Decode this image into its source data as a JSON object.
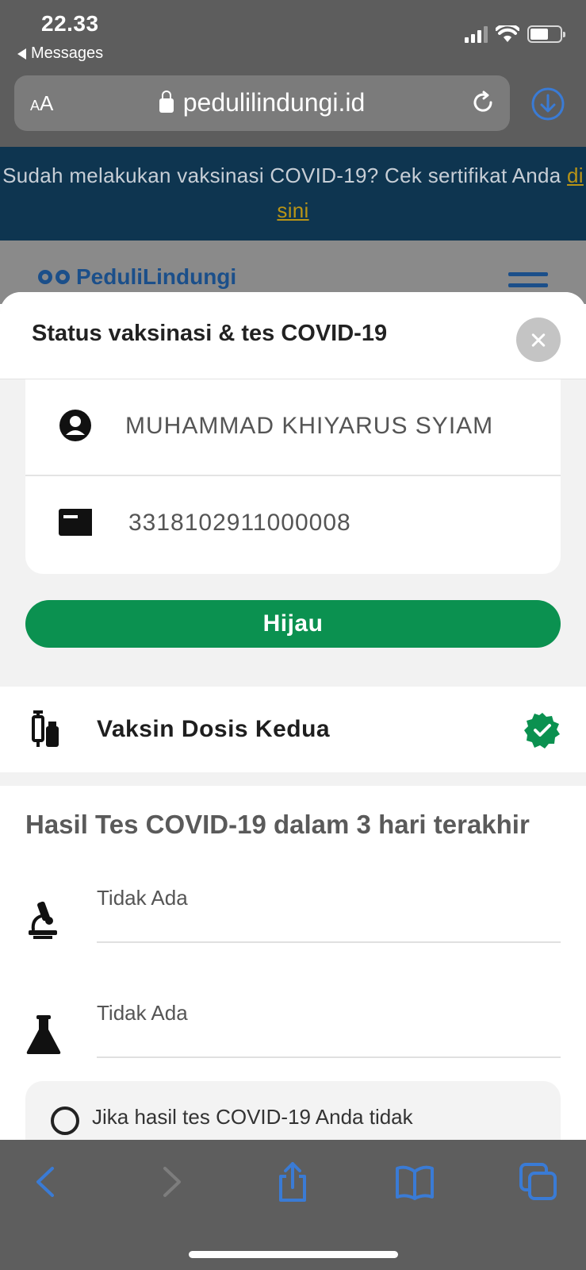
{
  "status_bar": {
    "time": "22.33",
    "back_app": "Messages"
  },
  "browser": {
    "text_size_label_small": "A",
    "text_size_label_large": "A",
    "url": "pedulilindungi.id"
  },
  "site": {
    "banner_text": "Sudah melakukan vaksinasi COVID-19? Cek sertifikat Anda",
    "banner_link": "di sini",
    "logo_text": "PeduliLindungi"
  },
  "sheet": {
    "title": "Status vaksinasi & tes COVID-19",
    "name": "MUHAMMAD KHIYARUS SYIAM",
    "nik": "3318102911000008",
    "status": "Hijau",
    "vaccine_status": "Vaksin Dosis Kedua",
    "tests_title": "Hasil Tes COVID-19 dalam 3 hari terakhir",
    "tests": [
      "Tidak Ada",
      "Tidak Ada"
    ],
    "info_text": "Jika hasil tes COVID-19 Anda tidak"
  },
  "colors": {
    "status_green": "#0b9150",
    "banner_bg": "#0e3550",
    "link_gold": "#b89417",
    "ios_blue": "#3a7bd5"
  },
  "icons": {
    "person": "person-icon",
    "id_card": "id-card-icon",
    "vaccine": "vaccine-icon",
    "verified": "verified-badge-icon",
    "microscope": "microscope-icon",
    "flask": "flask-icon"
  }
}
